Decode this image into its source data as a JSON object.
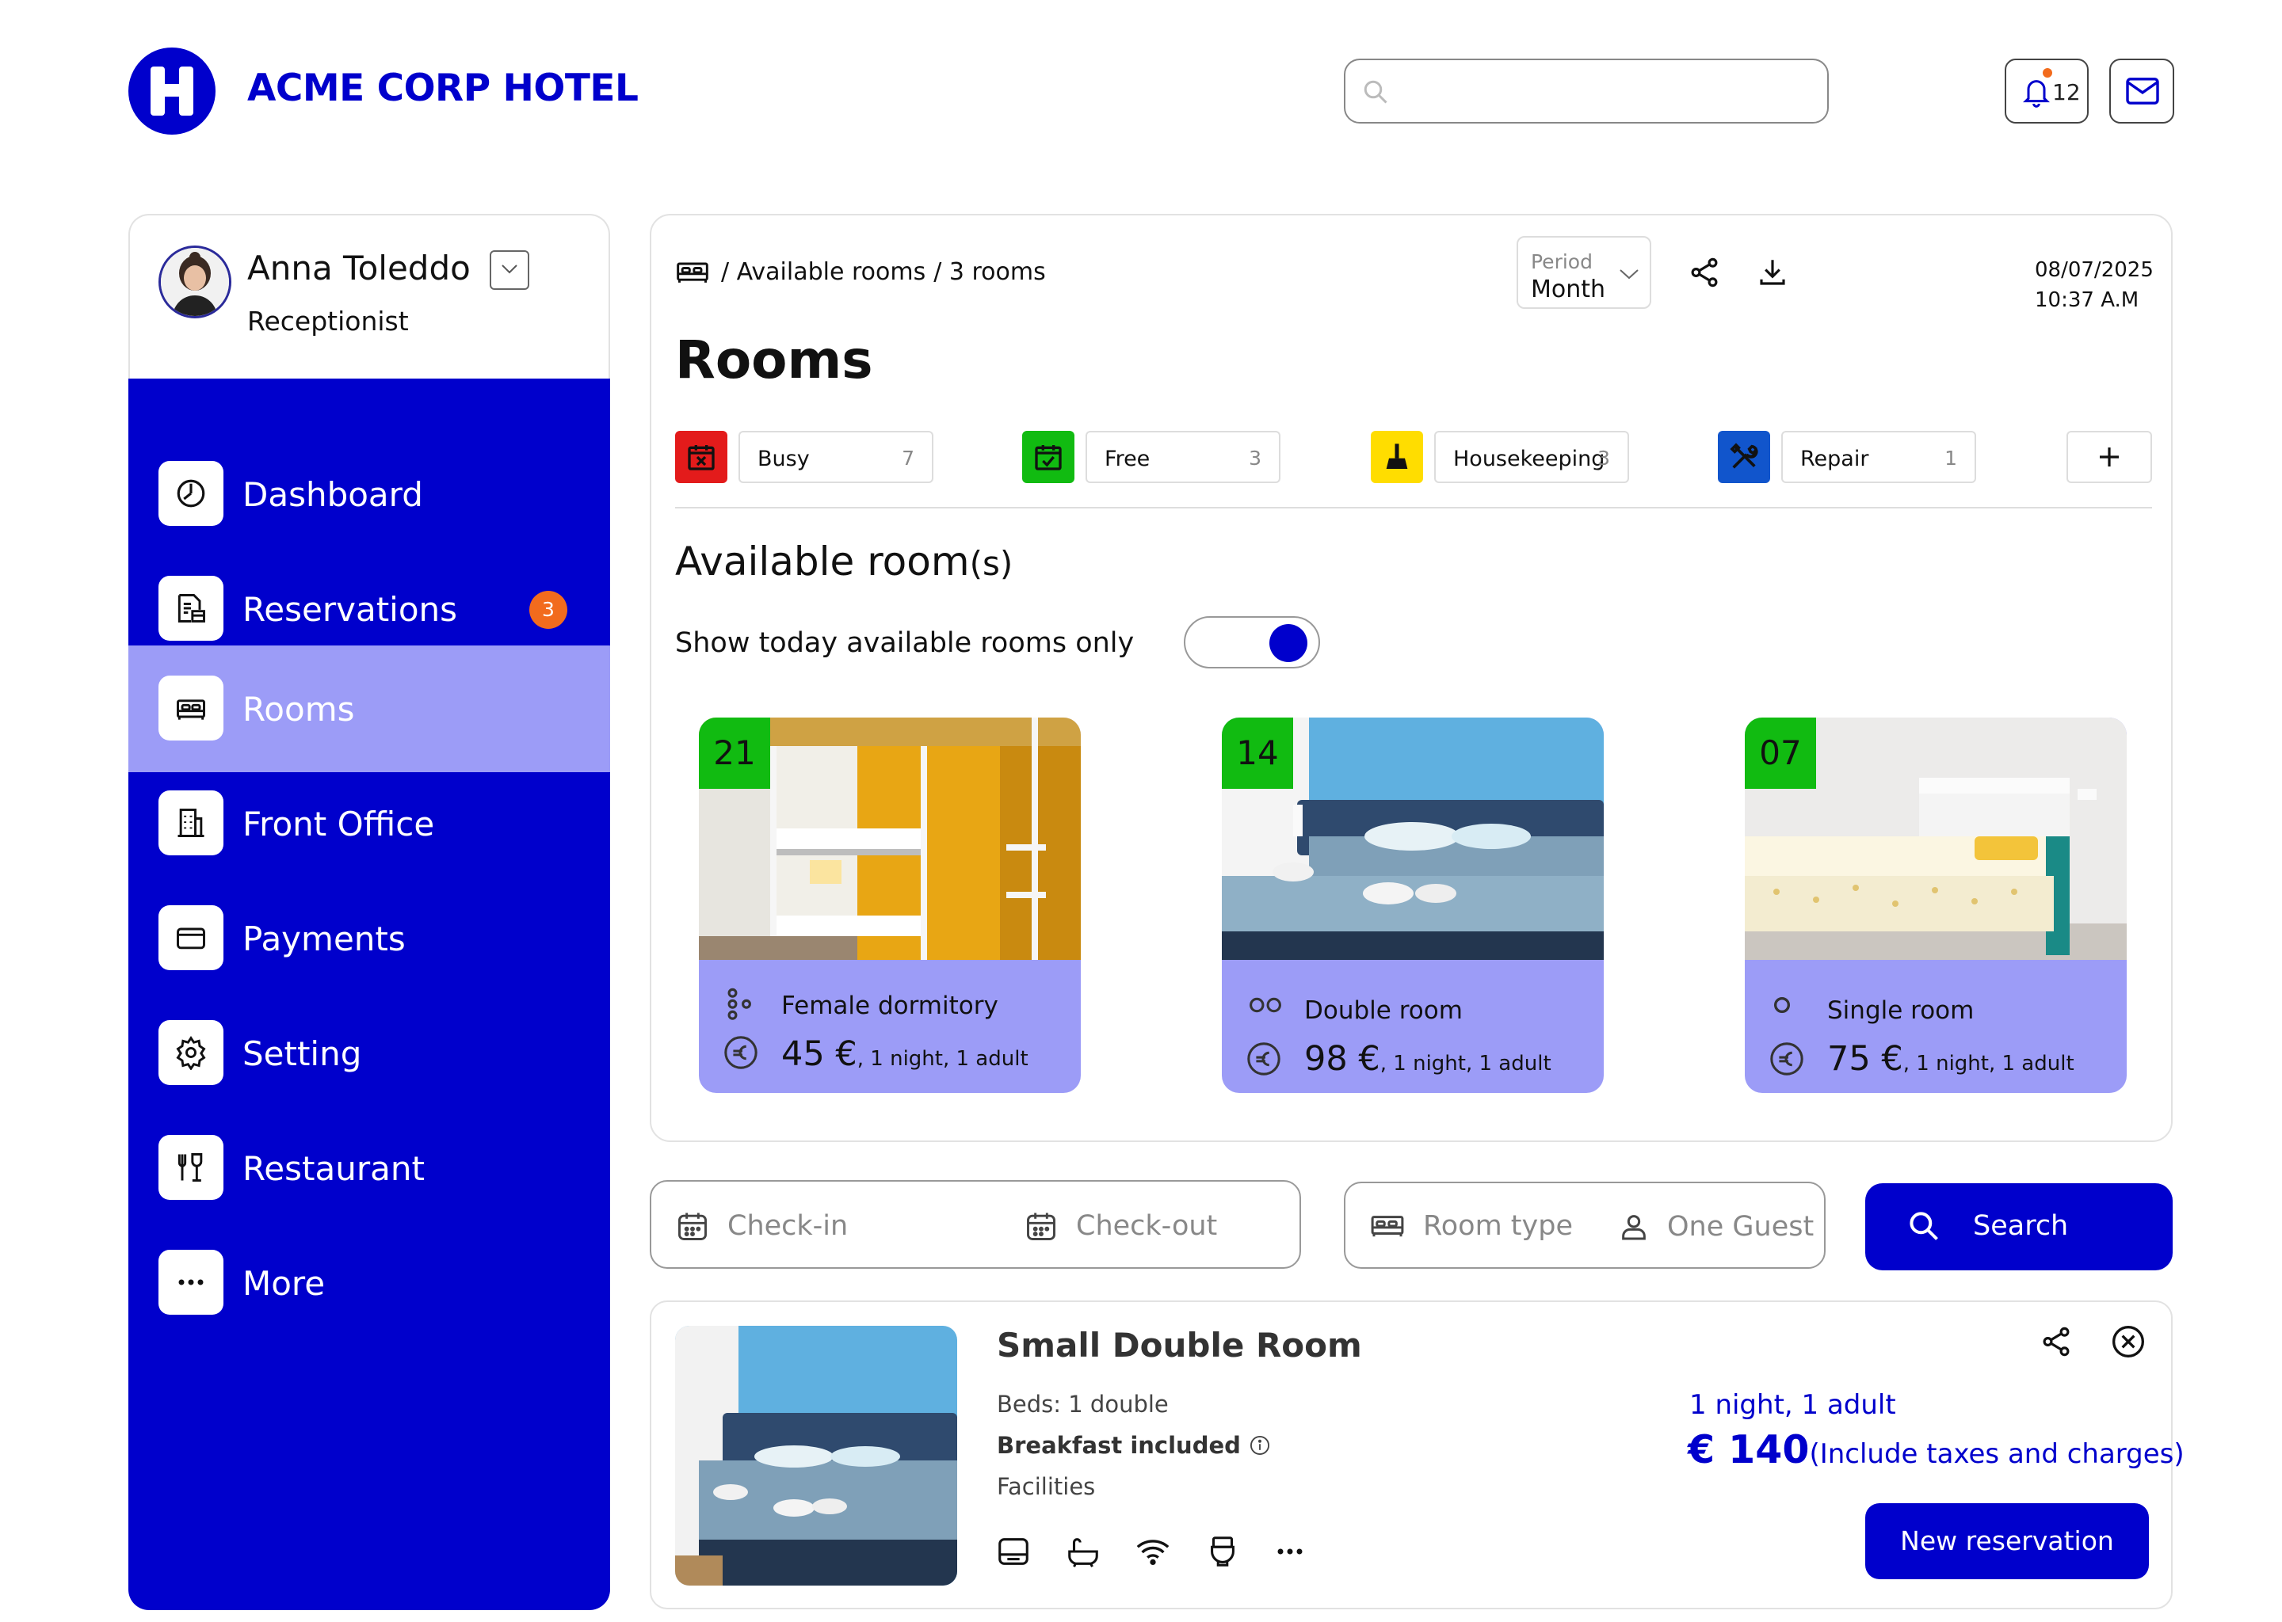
{
  "header": {
    "brand": "ACME CORP HOTEL",
    "search_placeholder": "",
    "notifications_count": "12"
  },
  "user": {
    "name": "Anna Toleddo",
    "role": "Receptionist"
  },
  "sidebar": {
    "items": [
      {
        "label": "Dashboard",
        "icon": "dashboard-icon"
      },
      {
        "label": "Reservations",
        "icon": "reservations-icon",
        "badge": "3"
      },
      {
        "label": "Rooms",
        "icon": "bed-icon",
        "active": true
      },
      {
        "label": "Front Office",
        "icon": "building-icon"
      },
      {
        "label": "Payments",
        "icon": "card-icon"
      },
      {
        "label": "Setting",
        "icon": "gear-icon"
      },
      {
        "label": "Restaurant",
        "icon": "cutlery-icon"
      },
      {
        "label": "More",
        "icon": "more-icon"
      }
    ]
  },
  "rooms_panel": {
    "breadcrumb": {
      "part1": "/ Available rooms",
      "part2": "/ 3 rooms"
    },
    "period": {
      "label": "Period",
      "value": "Month"
    },
    "date": "08/07/2025",
    "time": "10:37 A.M",
    "title": "Rooms",
    "statuses": [
      {
        "name": "Busy",
        "count": "7",
        "color": "#e31b1b"
      },
      {
        "name": "Free",
        "count": "3",
        "color": "#11bb11"
      },
      {
        "name": "Housekeeping",
        "count": "3",
        "color": "#ffdd00"
      },
      {
        "name": "Repair",
        "count": "1",
        "color": "#1155cc"
      }
    ],
    "available_title": "Available room",
    "available_suffix": "(s)",
    "toggle_label": "Show today available rooms only",
    "toggle_on": true,
    "cards": [
      {
        "number": "21",
        "type": "Female dormitory",
        "price": "45 €",
        "sub": ", 1 night, 1 adult"
      },
      {
        "number": "14",
        "type": "Double room",
        "price": "98 €",
        "sub": ", 1 night, 1 adult"
      },
      {
        "number": "07",
        "type": "Single room",
        "price": "75 €",
        "sub": ", 1 night, 1 adult"
      }
    ]
  },
  "search_bar": {
    "checkin": "Check-in",
    "checkout": "Check-out",
    "room_type": "Room type",
    "guests": "One Guest",
    "search": "Search"
  },
  "result": {
    "title": "Small Double Room",
    "beds": "Beds: 1 double",
    "breakfast": "Breakfast included",
    "facilities": "Facilities",
    "nights": "1 night, 1 adult",
    "price": "€ 140",
    "price_note": "(Include taxes and charges)",
    "cta": "New reservation"
  },
  "colors": {
    "primary": "#0000cc",
    "active_nav": "#9c9cf7",
    "card_bg": "#9c9cf7",
    "badge": "#f26b1d",
    "room_number_bg": "#11bb11"
  }
}
